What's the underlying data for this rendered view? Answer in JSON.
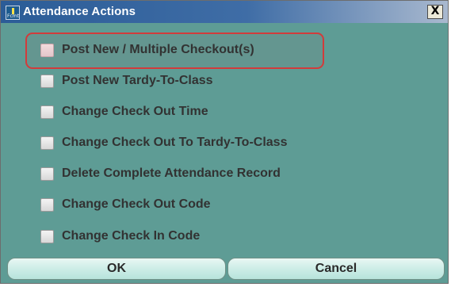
{
  "window": {
    "title": "Attendance Actions",
    "app_icon": "app-icon",
    "app_icon_text": "Fcmt",
    "close_glyph": "X"
  },
  "options": [
    {
      "label": "Post New / Multiple Checkout(s)",
      "checked": false,
      "highlighted": true
    },
    {
      "label": "Post New Tardy-To-Class",
      "checked": false
    },
    {
      "label": "Change Check Out Time",
      "checked": false
    },
    {
      "label": "Change Check Out To Tardy-To-Class",
      "checked": false
    },
    {
      "label": "Delete Complete Attendance Record",
      "checked": false
    },
    {
      "label": "Change Check Out Code",
      "checked": false
    },
    {
      "label": "Change Check In Code",
      "checked": false
    }
  ],
  "buttons": {
    "ok_label": "OK",
    "cancel_label": "Cancel"
  },
  "colors": {
    "dialog_bg": "#5e9c95",
    "title_bar": "#2b5c97",
    "highlight_border": "#d23b3b",
    "button_fill": "#cfeee8"
  }
}
